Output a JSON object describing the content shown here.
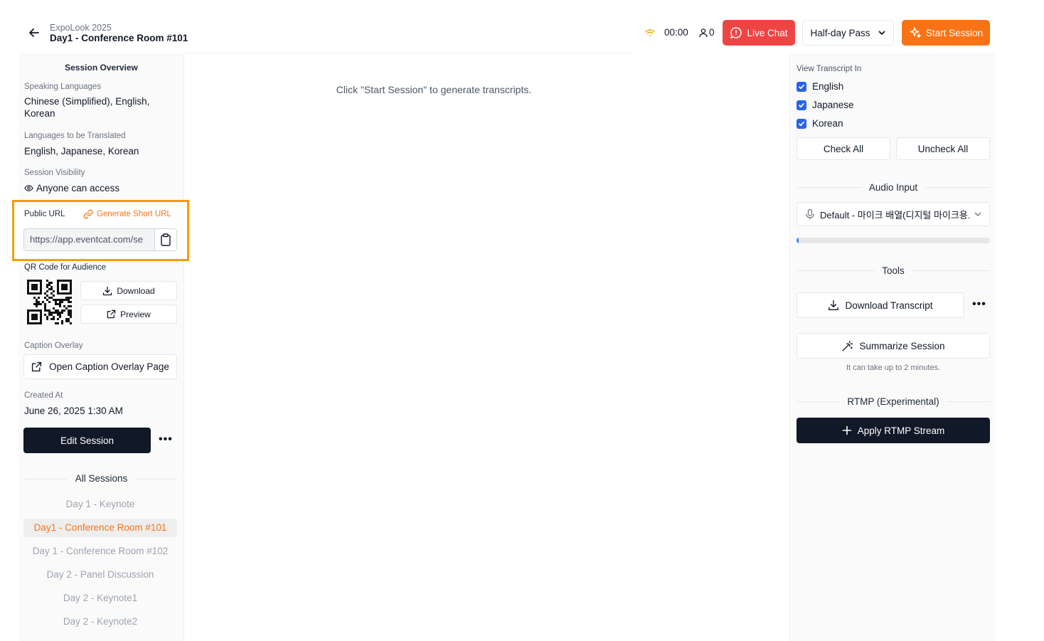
{
  "header": {
    "event_name": "ExpoLook 2025",
    "session_name": "Day1 - Conference Room #101",
    "timer": "00:00",
    "audience_count": "0",
    "live_chat_label": "Live Chat",
    "pass_selected": "Half-day Pass",
    "start_session_label": "Start Session",
    "icons": {
      "back": "back-arrow-icon",
      "wifi": "wifi-icon",
      "user": "user-icon",
      "chat": "chat-bubble-icon",
      "chevron": "chevron-down-icon",
      "sparkle": "sparkle-icon"
    }
  },
  "overview": {
    "title": "Session Overview",
    "speaking_languages_label": "Speaking Languages",
    "speaking_languages": "Chinese (Simplified), English, Korean",
    "translated_label": "Languages to be Translated",
    "translated_languages": "English, Japanese, Korean",
    "visibility_label": "Session Visibility",
    "visibility_value": "Anyone can access",
    "public_url_label": "Public URL",
    "generate_short_url_label": "Generate Short URL",
    "public_url_value": "https://app.eventcat.com/se",
    "qr_label": "QR Code for Audience",
    "download_label": "Download",
    "preview_label": "Preview",
    "caption_label": "Caption Overlay",
    "open_caption_label": "Open Caption Overlay Page",
    "created_label": "Created At",
    "created_value": "June 26, 2025 1:30 AM",
    "edit_label": "Edit Session",
    "more_label": "•••"
  },
  "sessions": {
    "title": "All Sessions",
    "items": [
      {
        "label": "Day 1 - Keynote",
        "active": false
      },
      {
        "label": "Day1 - Conference Room #101",
        "active": true
      },
      {
        "label": "Day 1 - Conference Room #102",
        "active": false
      },
      {
        "label": "Day 2 - Panel Discussion",
        "active": false
      },
      {
        "label": "Day 2 - Keynote1",
        "active": false
      },
      {
        "label": "Day 2 - Keynote2",
        "active": false
      }
    ]
  },
  "main": {
    "empty_message": "Click \"Start Session\" to generate transcripts."
  },
  "right": {
    "view_transcript_label": "View Transcript In",
    "languages": [
      {
        "label": "English",
        "checked": true
      },
      {
        "label": "Japanese",
        "checked": true
      },
      {
        "label": "Korean",
        "checked": true
      }
    ],
    "check_all_label": "Check All",
    "uncheck_all_label": "Uncheck All",
    "audio_input_title": "Audio Input",
    "audio_device": "Default - 마이크 배열(디지털 마이크용...",
    "audio_level": 0.01,
    "tools_title": "Tools",
    "download_transcript_label": "Download Transcript",
    "more_label": "•••",
    "summarize_label": "Summarize Session",
    "summarize_hint": "It can take up to 2 minutes.",
    "rtmp_title": "RTMP (Experimental)",
    "apply_rtmp_label": "Apply RTMP Stream"
  },
  "colors": {
    "accent_orange": "#f97316",
    "live_red": "#ef4444",
    "highlight_border": "#f59e0b",
    "checkbox_blue": "#2563eb",
    "dark_button": "#111827"
  }
}
